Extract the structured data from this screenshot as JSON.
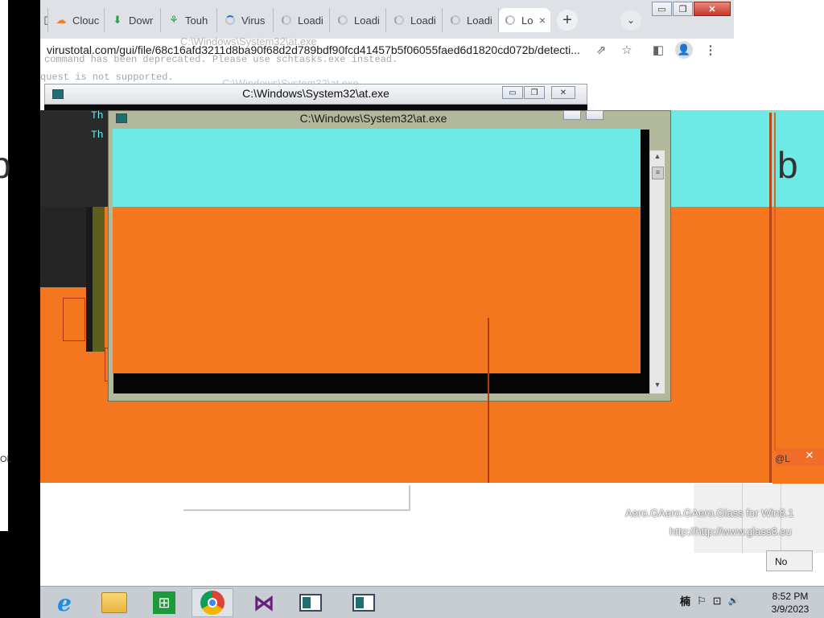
{
  "browser": {
    "tabs": [
      {
        "label": "",
        "icon": "partial-tab-icon"
      },
      {
        "label": "Clouc",
        "icon": "cloudflare-icon"
      },
      {
        "label": "Dowr",
        "icon": "download-icon"
      },
      {
        "label": "Touh",
        "icon": "site-icon"
      },
      {
        "label": "Virus",
        "icon": "loading-spinner-icon"
      },
      {
        "label": "Loadi",
        "icon": "loading-spinner-icon"
      },
      {
        "label": "Loadi",
        "icon": "loading-spinner-icon"
      },
      {
        "label": "Loadi",
        "icon": "loading-spinner-icon"
      },
      {
        "label": "Loadi",
        "icon": "loading-spinner-icon"
      },
      {
        "label": "Lo",
        "icon": "loading-spinner-icon"
      }
    ],
    "tab_close": "×",
    "new_tab": "+",
    "tab_search": "⌄",
    "window_controls": {
      "minimize": "▭",
      "maximize": "❐",
      "close": "✕"
    },
    "url": "virustotal.com/gui/file/68c16afd3211d8ba90f68d2d789bdf90fcd41457b5f06055faed6d1820cd072b/detecti..."
  },
  "console_back": {
    "title": "C:\\Windows\\System32\\at.exe",
    "lines": [
      "Th",
      "Th"
    ],
    "ghost_lines": [
      "command has been deprecated. Please use schtasks.exe instead.",
      "quest is not supported."
    ],
    "ghost_titles": [
      "C:\\Windows\\System32\\at.exe",
      "C:\\Windows\\System32\\at.exe"
    ]
  },
  "console_front": {
    "title": "C:\\Windows\\System32\\at.exe"
  },
  "edge_glyphs": {
    "left": "b",
    "right": "b"
  },
  "watermark": {
    "line1": "Aero.GAero.GAero.Glass for Win8.1",
    "line2": "http://http://www.glass8.eu"
  },
  "dialog": {
    "no_label": "No",
    "tag": "@L",
    "left_tag": "OL"
  },
  "taskbar": {
    "items": [
      {
        "name": "internet-explorer",
        "glyph": "e"
      },
      {
        "name": "file-explorer",
        "glyph": "▤"
      },
      {
        "name": "store",
        "glyph": "⊞"
      },
      {
        "name": "chrome",
        "glyph": ""
      },
      {
        "name": "visual-studio",
        "glyph": "⋈"
      },
      {
        "name": "console-window-1",
        "glyph": "▣"
      },
      {
        "name": "console-window-2",
        "glyph": "▣"
      }
    ],
    "tray": {
      "ime": "楠",
      "flag": "⚐",
      "network": "⊡",
      "volume": "🔊"
    },
    "clock": {
      "time": "8:52 PM",
      "date": "3/9/2023"
    }
  },
  "colors": {
    "orange": "#f47720",
    "cyan": "#6de9e6",
    "taskbar": "#c8cdd3"
  }
}
